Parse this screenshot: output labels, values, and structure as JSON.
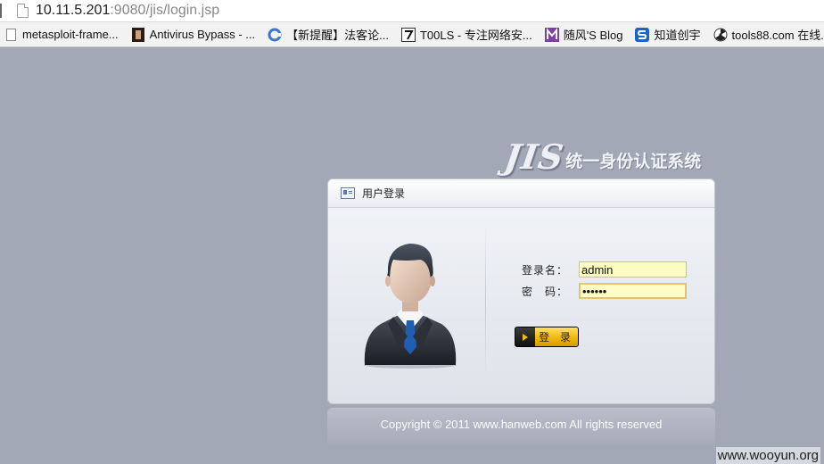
{
  "browser": {
    "url_host": "10.11.5.201",
    "url_rest": ":9080/jis/login.jsp",
    "bookmarks": [
      {
        "icon": "bookmark-page-icon",
        "label": "metasploit-frame..."
      },
      {
        "icon": "film-strip-icon",
        "label": "Antivirus Bypass - ..."
      },
      {
        "icon": "refresh-circle-icon",
        "label": "【新提醒】法客论..."
      },
      {
        "icon": "number-7-icon",
        "label": "T00LS - 专注网络安..."
      },
      {
        "icon": "letter-m-icon",
        "label": "随风'S Blog"
      },
      {
        "icon": "letter-s-icon",
        "label": "知道创宇"
      },
      {
        "icon": "radiation-icon",
        "label": "tools88.com 在线..."
      }
    ]
  },
  "app": {
    "logo_text": "JIS",
    "system_title": "统一身份认证系统",
    "panel_title": "用户登录",
    "username_label": "登录名：",
    "username_value": "admin",
    "password_label": "密　码：",
    "password_value": "••••••",
    "login_button": "登 录",
    "copyright": "Copyright © 2011 www.hanweb.com All rights reserved"
  },
  "watermark": "www.wooyun.org"
}
